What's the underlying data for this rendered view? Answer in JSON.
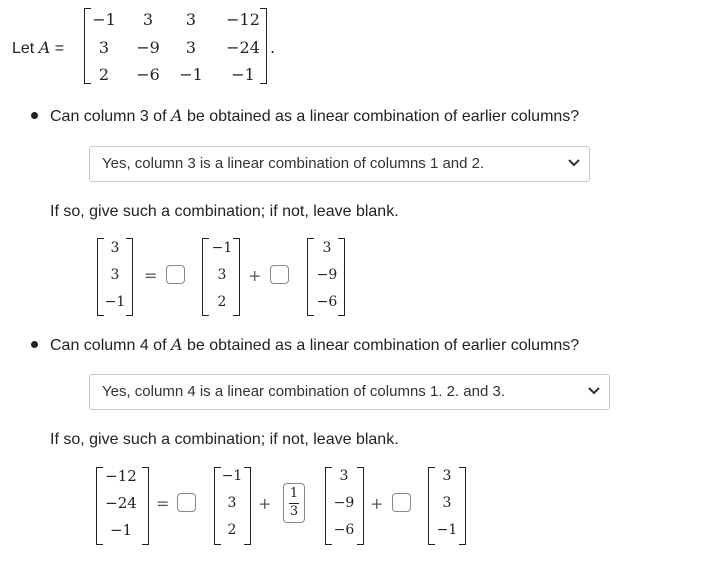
{
  "intro": {
    "let_text": "Let",
    "matrix_name": "A",
    "equals": "=",
    "period": "."
  },
  "matrix_A": [
    [
      "−1",
      "3",
      "3",
      "−12"
    ],
    [
      "3",
      "−9",
      "3",
      "−24"
    ],
    [
      "2",
      "−6",
      "−1",
      "−1"
    ]
  ],
  "question1": {
    "before": "Can column 3 of ",
    "var": "A",
    "after": " be obtained as a linear combination of earlier columns?",
    "selected_option": "Yes, column 3 is a linear combination of columns 1 and 2.",
    "instruction": "If so, give such a combination; if not, leave blank.",
    "target": [
      "3",
      "3",
      "−1"
    ],
    "col1": [
      "−1",
      "3",
      "2"
    ],
    "col2": [
      "3",
      "−9",
      "−6"
    ],
    "coef1": "",
    "coef2": ""
  },
  "question2": {
    "before": "Can column 4 of ",
    "var": "A",
    "after": " be obtained as a linear combination of earlier columns?",
    "selected_option": "Yes, column 4 is a linear combination of columns 1. 2. and 3.",
    "instruction": "If so, give such a combination; if not, leave blank.",
    "target": [
      "−12",
      "−24",
      "−1"
    ],
    "col1": [
      "−1",
      "3",
      "2"
    ],
    "col2": [
      "3",
      "−9",
      "−6"
    ],
    "col3": [
      "3",
      "3",
      "−1"
    ],
    "coef1": "",
    "coef2_num": "1",
    "coef2_den": "3",
    "coef3": ""
  },
  "operators": {
    "equals": "=",
    "plus": "+"
  },
  "icons": {
    "dropdown": "chevron-down-icon"
  }
}
